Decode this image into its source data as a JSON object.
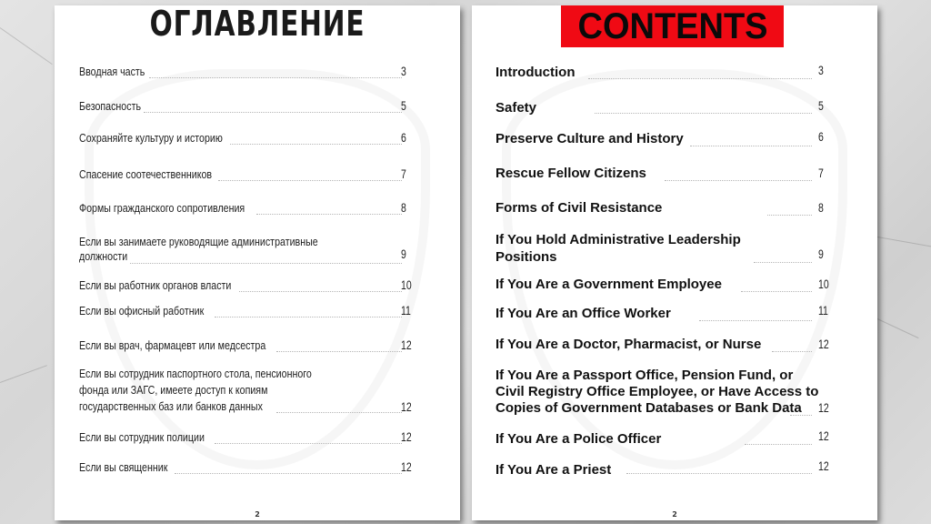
{
  "left_page": {
    "title": "ОГЛАВЛЕНИЕ",
    "page_number": "2",
    "entries": [
      {
        "text": "Вводная часть",
        "page": "3"
      },
      {
        "text": "Безопасность",
        "page": "5"
      },
      {
        "text": "Сохраняйте культуру и историю",
        "page": "6"
      },
      {
        "text": "Спасение соотечественников",
        "page": "7"
      },
      {
        "text": "Формы гражданского сопротивления",
        "page": "8"
      },
      {
        "text": "Если вы занимаете руководящие административные\nдолжности",
        "page": "9"
      },
      {
        "text": "Если вы работник органов власти",
        "page": "10"
      },
      {
        "text": "Если вы офисный работник",
        "page": "11"
      },
      {
        "text": "Если вы врач, фармацевт или медсестра",
        "page": "12"
      },
      {
        "text": "Если вы сотрудник паспортного стола, пенсионного\nфонда или ЗАГС, имеете доступ к копиям\nгосударственных баз или банков данных",
        "page": "12"
      },
      {
        "text": "Если вы сотрудник полиции",
        "page": "12"
      },
      {
        "text": "Если вы священник",
        "page": "12"
      }
    ]
  },
  "right_page": {
    "title": "CONTENTS",
    "title_bg_color": "#f00a14",
    "page_number": "2",
    "entries": [
      {
        "text": "Introduction",
        "page": "3"
      },
      {
        "text": "Safety",
        "page": "5"
      },
      {
        "text": "Preserve Culture and History",
        "page": "6"
      },
      {
        "text": "Rescue Fellow Citizens",
        "page": "7"
      },
      {
        "text": "Forms of Civil Resistance",
        "page": "8"
      },
      {
        "text": "If You Hold Administrative Leadership\nPositions",
        "page": "9"
      },
      {
        "text": "If You Are a Government Employee",
        "page": "10"
      },
      {
        "text": "If You Are an Office Worker",
        "page": "11"
      },
      {
        "text": "If You Are a Doctor, Pharmacist, or Nurse",
        "page": "12"
      },
      {
        "text": "If You Are a Passport Office, Pension Fund, or\nCivil Registry Office Employee, or Have Access to\nCopies of Government Databases or Bank Data",
        "page": "12"
      },
      {
        "text": "If You Are a Police Officer",
        "page": "12"
      },
      {
        "text": "If You Are a Priest",
        "page": "12"
      }
    ]
  }
}
